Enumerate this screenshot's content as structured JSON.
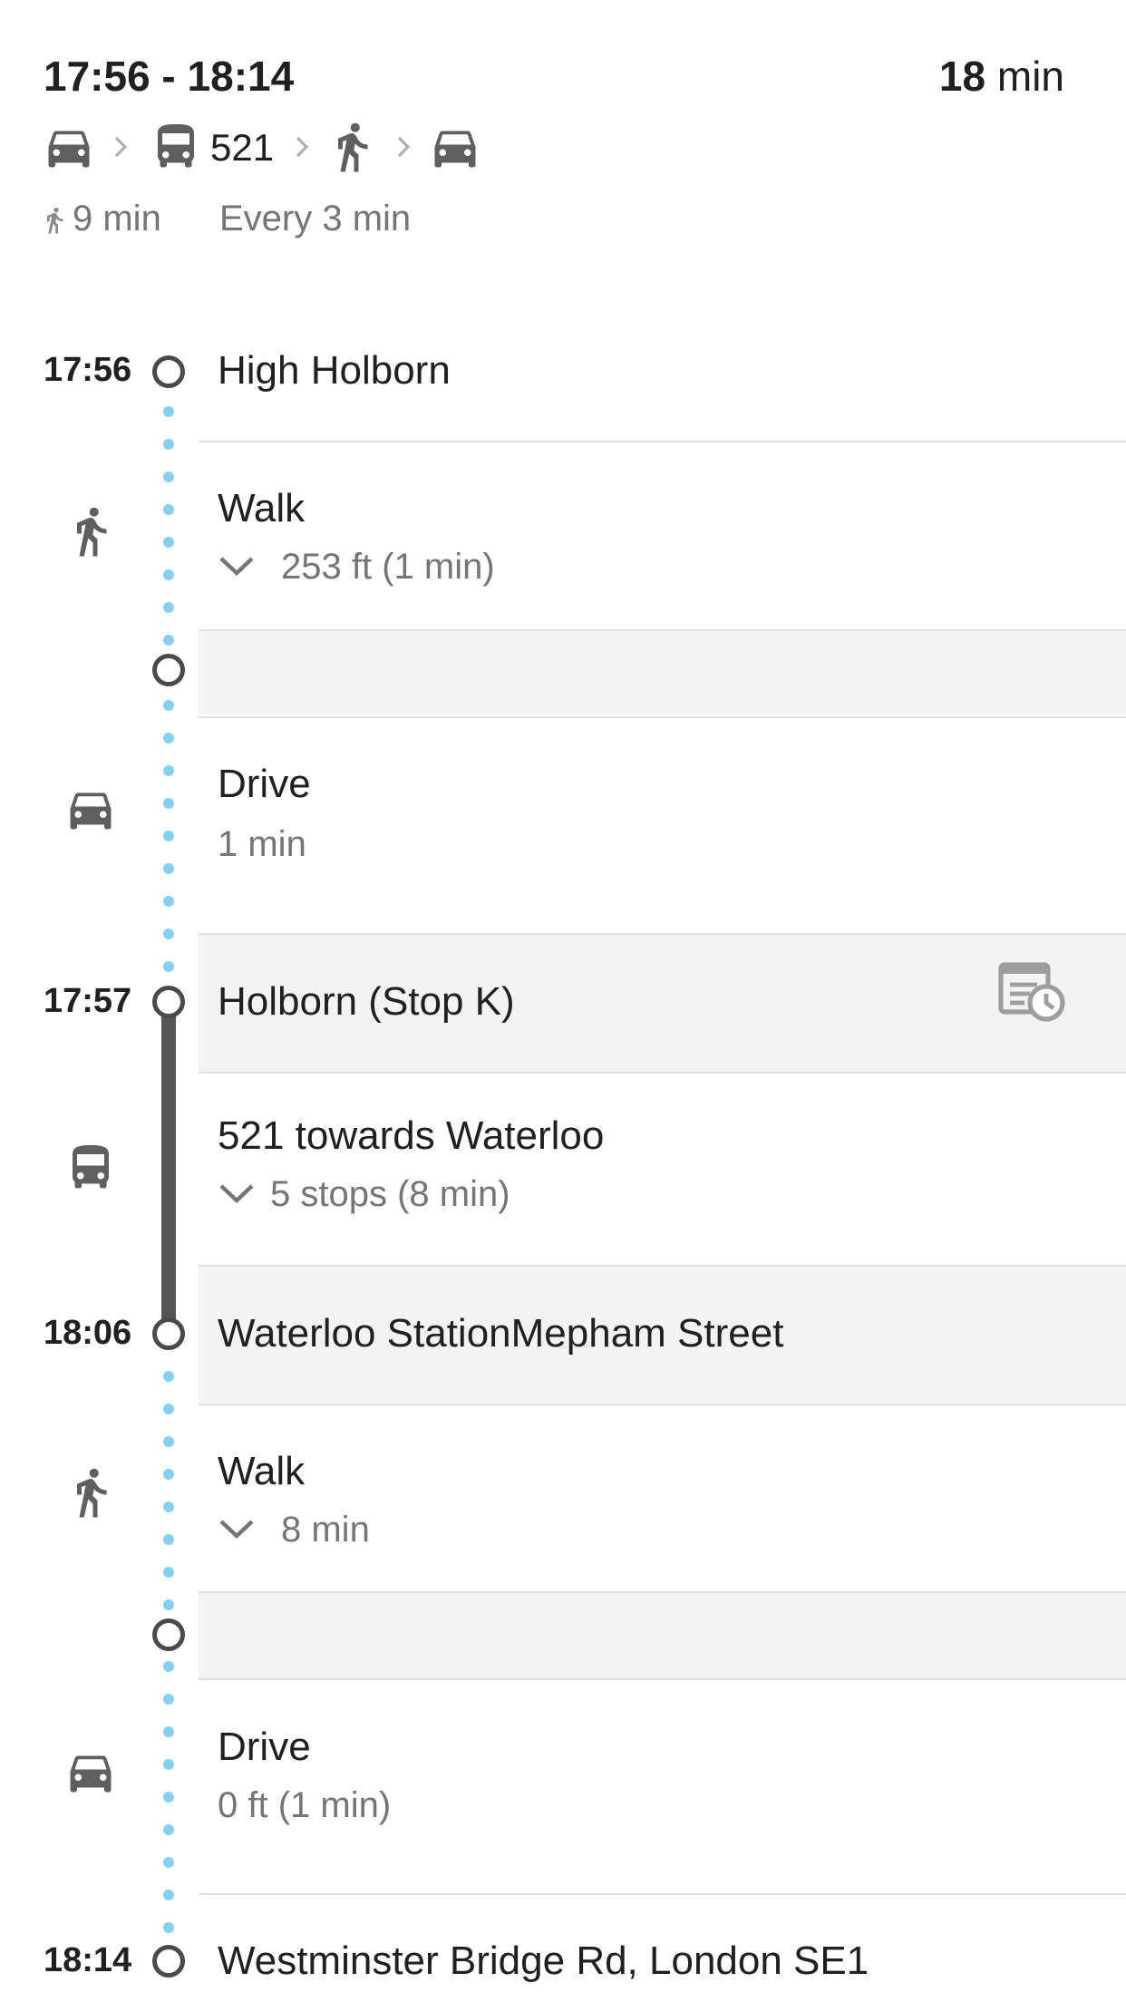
{
  "header": {
    "time_range": "17:56 - 18:14",
    "duration_value": "18",
    "duration_unit": "min"
  },
  "route_summary": {
    "modes": [
      "car-icon",
      "bus-icon",
      "walk-icon",
      "car-icon"
    ],
    "bus_number": "521",
    "walk_time": "9 min",
    "frequency": "Every 3 min"
  },
  "timeline": {
    "stops": [
      {
        "time": "17:56",
        "name": "High Holborn"
      },
      {
        "time": "",
        "name": ""
      },
      {
        "time": "17:57",
        "name": "Holborn (Stop K)"
      },
      {
        "time": "18:06",
        "name": "Waterloo StationMepham Street"
      },
      {
        "time": "",
        "name": ""
      },
      {
        "time": "18:14",
        "name": "Westminster Bridge Rd, London SE1"
      }
    ],
    "legs": [
      {
        "mode": "walk-icon",
        "title": "Walk",
        "detail": "253 ft (1 min)",
        "expandable": true
      },
      {
        "mode": "car-icon",
        "title": "Drive",
        "detail": "1 min",
        "expandable": false
      },
      {
        "mode": "bus-icon",
        "title": "521 towards Waterloo",
        "detail": "5 stops (8 min)",
        "expandable": true
      },
      {
        "mode": "walk-icon",
        "title": "Walk",
        "detail": "8 min",
        "expandable": true
      },
      {
        "mode": "car-icon",
        "title": "Drive",
        "detail": "0 ft (1 min)",
        "expandable": false
      }
    ]
  },
  "colors": {
    "walk_line": "#80d0f8",
    "transit_line": "#555555",
    "stop_shade": "#f3f3f3",
    "secondary_text": "#757575"
  }
}
